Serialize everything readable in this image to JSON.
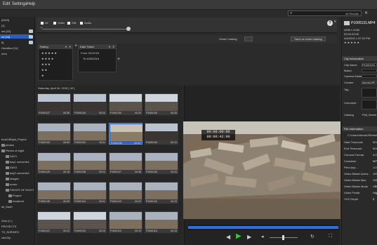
{
  "menu": {
    "items": [
      "Edit",
      "Settings",
      "Help"
    ]
  },
  "search": {
    "count": "## Results",
    "placeholder": ""
  },
  "sidebar": {
    "items": [
      {
        "label": "[2620]"
      },
      {
        "label": "[1]"
      },
      {
        "label": "set [42]"
      },
      {
        "label": "ce [44]",
        "selected": true
      },
      {
        "label": "8]"
      },
      {
        "label": "Heratlion [11]"
      },
      {
        "label": "ures"
      }
    ],
    "folders": [
      {
        "label": "tousOfEight_Project"
      },
      {
        "label": "photos"
      },
      {
        "label": "Pieces of eight"
      },
      {
        "label": "DAY1"
      },
      {
        "label": "day1 converted"
      },
      {
        "label": "DAY2"
      },
      {
        "label": "day2 converted"
      },
      {
        "label": "images"
      },
      {
        "label": "music"
      },
      {
        "label": "PIECES OF EIGHT"
      },
      {
        "label": "Project"
      },
      {
        "label": "rendered"
      },
      {
        "label": "all_Day0"
      },
      {
        "label": "Disk (C:)"
      },
      {
        "label": "PROJECTS"
      },
      {
        "label": "TS_SHRINFO"
      },
      {
        "label": "cheClip"
      }
    ]
  },
  "filter": {
    "checks": [
      "All",
      "Video",
      "Still",
      "Audio"
    ]
  },
  "smart": {
    "label": "Smart Catalog",
    "save_label": "Save as smart catalog"
  },
  "rating": {
    "title": "Rating",
    "rows": [
      "★★★★★",
      "★★★★",
      "★★★",
      "★★",
      "★"
    ]
  },
  "date": {
    "title": "Date Taken",
    "from": "From 3/1/2015",
    "to": "To 6/30/2015"
  },
  "grid": {
    "title": "Saturday, April 04, 2015 [ 42 ]",
    "thumbs": [
      {
        "name": "P1000127",
        "dur": "00:36",
        "tone": "dark"
      },
      {
        "name": "P1000126",
        "dur": "00:24",
        "tone": "dark"
      },
      {
        "name": "P1000130",
        "dur": "00:23",
        "tone": "sky"
      },
      {
        "name": "P1000125",
        "dur": "00:25",
        "tone": "sky"
      },
      {
        "name": "P1000133",
        "dur": "00:09",
        "tone": "land"
      },
      {
        "name": "P1000132",
        "dur": "00:11",
        "tone": "land"
      },
      {
        "name": "P1000131",
        "dur": "00:42",
        "tone": "rubble",
        "selected": true
      },
      {
        "name": "P1000134",
        "dur": "00:12",
        "tone": "dark"
      },
      {
        "name": "P1000129",
        "dur": "00:15",
        "tone": "land"
      },
      {
        "name": "P1000128",
        "dur": "00:22",
        "tone": "land"
      },
      {
        "name": "P1000127",
        "dur": "00:36",
        "tone": "land"
      },
      {
        "name": "P1000126",
        "dur": "00:24",
        "tone": "land"
      },
      {
        "name": "P1000125",
        "dur": "00:25",
        "tone": "land"
      },
      {
        "name": "P1000124",
        "dur": "00:21",
        "tone": "land"
      },
      {
        "name": "P1000123",
        "dur": "00:22",
        "tone": "land"
      },
      {
        "name": "P1000122",
        "dur": "00:13",
        "tone": "land"
      },
      {
        "name": "P1000121",
        "dur": "00:23",
        "tone": "sky"
      },
      {
        "name": "P1000120",
        "dur": "00:23",
        "tone": "sky"
      },
      {
        "name": "P1000119",
        "dur": "00:13",
        "tone": "land"
      },
      {
        "name": "P1000118",
        "dur": "00:13",
        "tone": "land"
      }
    ]
  },
  "viewer": {
    "timecode_top": "00:00:00:00",
    "timecode_bottom": "00:00:42:00",
    "progress": 1.0
  },
  "info": {
    "filename": "P1000131.MP4",
    "line1": "4096 x 2160",
    "line2": "00:00:42:00",
    "line3": "4/4/2015 1:47:22 PM",
    "clipinfo_title": "Clip Information",
    "fields": [
      {
        "label": "Clip Name",
        "value": "P1000131"
      },
      {
        "label": "Maker",
        "value": ""
      },
      {
        "label": "Camera Model",
        "value": ""
      },
      {
        "label": "Creator",
        "value": "AlexisOfPi"
      },
      {
        "label": "Tag",
        "value": ""
      },
      {
        "label": "Comment",
        "value": ""
      },
      {
        "label": "Catalog",
        "value": "Poll_Green"
      }
    ],
    "file_title": "File Information",
    "path": "C:\\Users\\AlexisOfDeskt",
    "file_fields": [
      {
        "label": "Start Timecode",
        "value": "00:0"
      },
      {
        "label": "End Timecode",
        "value": "00:0"
      },
      {
        "label": "Chroma Format",
        "value": "4:2"
      },
      {
        "label": "Container",
        "value": "MP4"
      },
      {
        "label": "Pixel Asp...",
        "value": "1.0"
      },
      {
        "label": "Video Bitrate Avera...",
        "value": "100"
      },
      {
        "label": "Video Bitrate Max",
        "value": "110"
      },
      {
        "label": "Video Bitrate Mode",
        "value": "VBR"
      },
      {
        "label": "Video Profile",
        "value": "High"
      },
      {
        "label": "YUV Depth",
        "value": "8"
      }
    ]
  },
  "colors": {
    "accent": "#2f6fe0",
    "selection": "#2c61c8",
    "play": "#39c139"
  }
}
